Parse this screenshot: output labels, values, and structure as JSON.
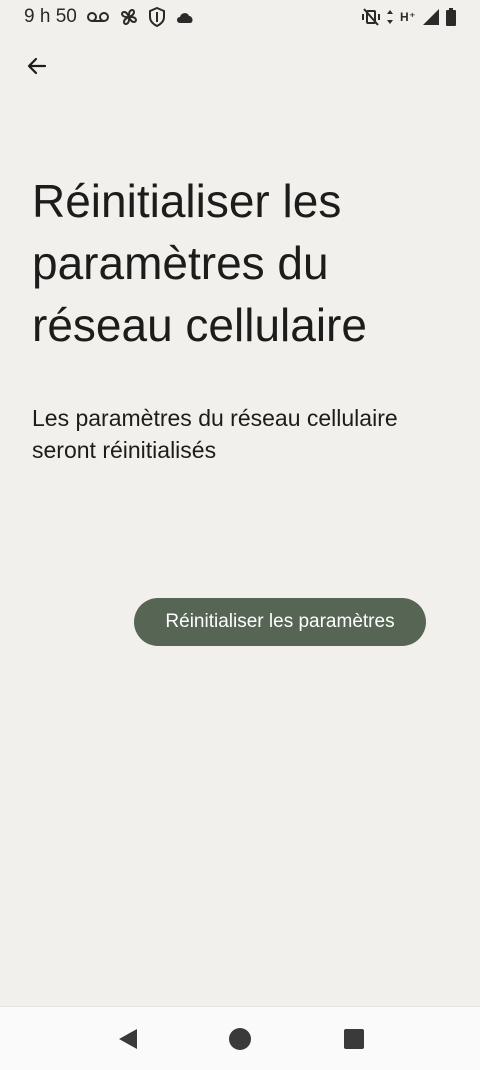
{
  "status_bar": {
    "time": "9 h 50",
    "network_type": "H⁺",
    "left_icons": [
      "voicemail-icon",
      "fan-icon",
      "shield-icon",
      "cloud-icon"
    ],
    "right_icons": [
      "vibrate-off-icon",
      "data-arrows-icon",
      "signal-icon",
      "battery-icon"
    ]
  },
  "header": {
    "back_icon": "arrow-left-icon"
  },
  "main": {
    "title": "Réinitialiser les paramètres du réseau cellulaire",
    "description": "Les paramètres du réseau cellulaire seront réinitialisés",
    "reset_button_label": "Réinitialiser les paramètres"
  },
  "nav_bar": {
    "icons": [
      "back-triangle-icon",
      "home-circle-icon",
      "recents-square-icon"
    ]
  },
  "colors": {
    "background": "#f1f0ec",
    "button": "#566554",
    "button_text": "#ffffff",
    "text": "#1c1c1a",
    "nav_background": "#fafafa"
  }
}
